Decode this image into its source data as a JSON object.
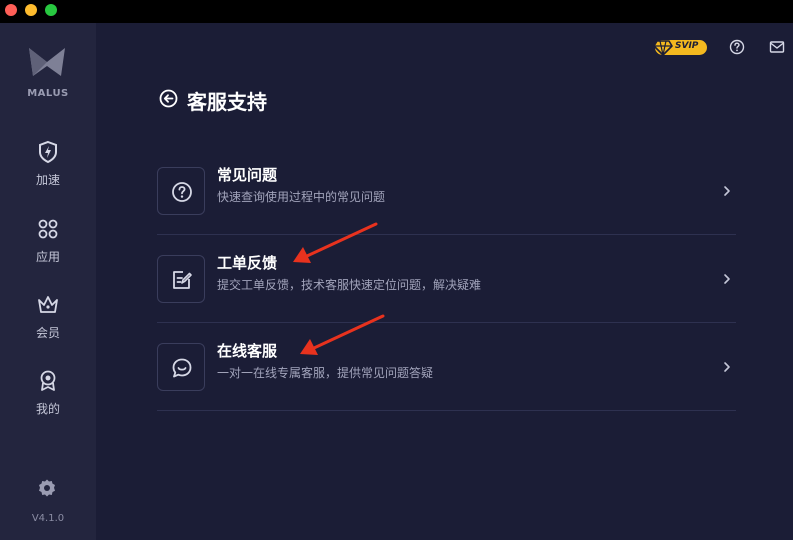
{
  "app": {
    "brand": "MALUS",
    "version": "V4.1.0"
  },
  "sidebar": {
    "items": [
      {
        "label": "加速",
        "icon": "shield-bolt-icon"
      },
      {
        "label": "应用",
        "icon": "apps-grid-icon"
      },
      {
        "label": "会员",
        "icon": "crown-icon"
      },
      {
        "label": "我的",
        "icon": "user-badge-icon"
      }
    ],
    "settings_icon": "gear-icon"
  },
  "header": {
    "svip_label": "SVIP",
    "help_icon": "question-icon",
    "mail_icon": "mail-icon"
  },
  "page": {
    "title": "客服支持",
    "back_icon": "back-arrow-icon"
  },
  "support": {
    "items": [
      {
        "title": "常见问题",
        "desc": "快速查询使用过程中的常见问题",
        "icon": "question-circle-icon"
      },
      {
        "title": "工单反馈",
        "desc": "提交工单反馈，技术客服快速定位问题，解决疑难",
        "icon": "edit-ticket-icon"
      },
      {
        "title": "在线客服",
        "desc": "一对一在线专属客服，提供常见问题答疑",
        "icon": "chat-bubble-icon"
      }
    ]
  },
  "colors": {
    "accent_gold": "#f3b81f",
    "annotation_red": "#e8321e",
    "background": "#1b1d36",
    "sidebar": "#23253e"
  }
}
